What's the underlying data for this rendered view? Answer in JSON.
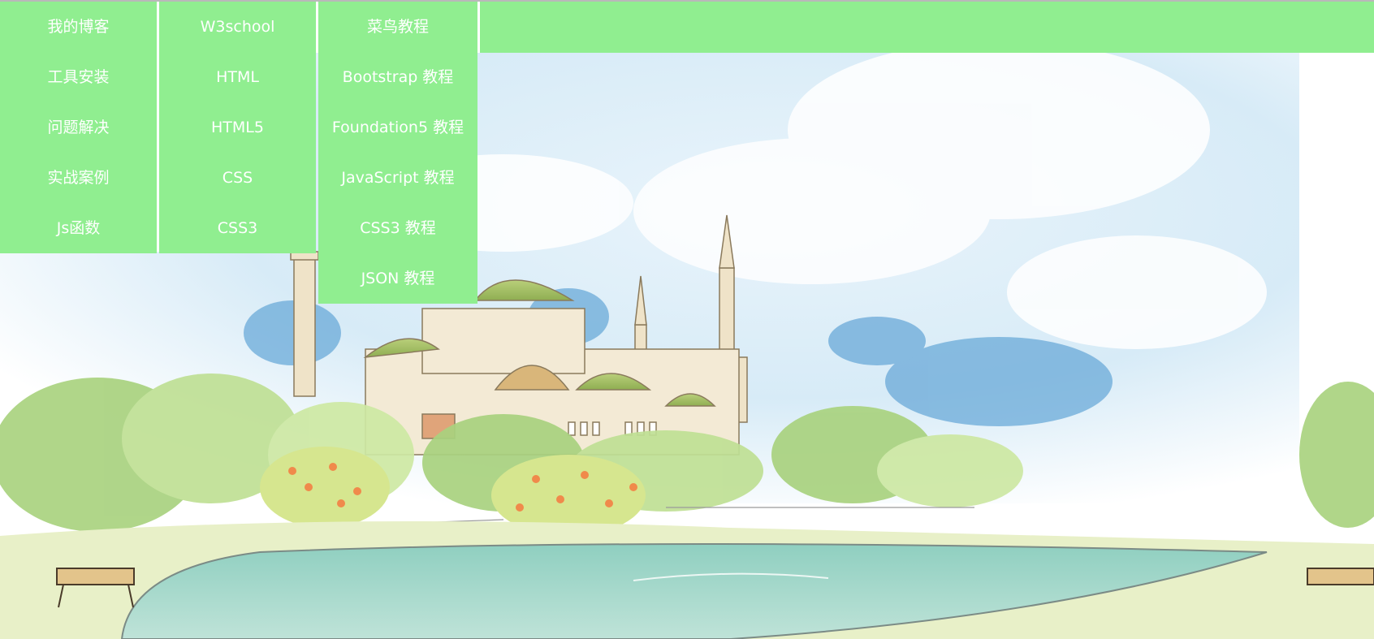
{
  "colors": {
    "menu_bg": "#90ee90",
    "menu_text": "#ffffff",
    "sky": "#cfe6f5"
  },
  "menu": {
    "columns": [
      {
        "items": [
          "我的博客",
          "工具安装",
          "问题解决",
          "实战案例",
          "Js函数"
        ]
      },
      {
        "items": [
          "W3school",
          "HTML",
          "HTML5",
          "CSS",
          "CSS3"
        ]
      },
      {
        "items": [
          "菜鸟教程",
          "Bootstrap 教程",
          "Foundation5 教程",
          "JavaScript 教程",
          "CSS3 教程",
          "JSON 教程"
        ]
      }
    ]
  },
  "banner": {
    "icon": "watercolor-mosque-landscape-illustration"
  }
}
